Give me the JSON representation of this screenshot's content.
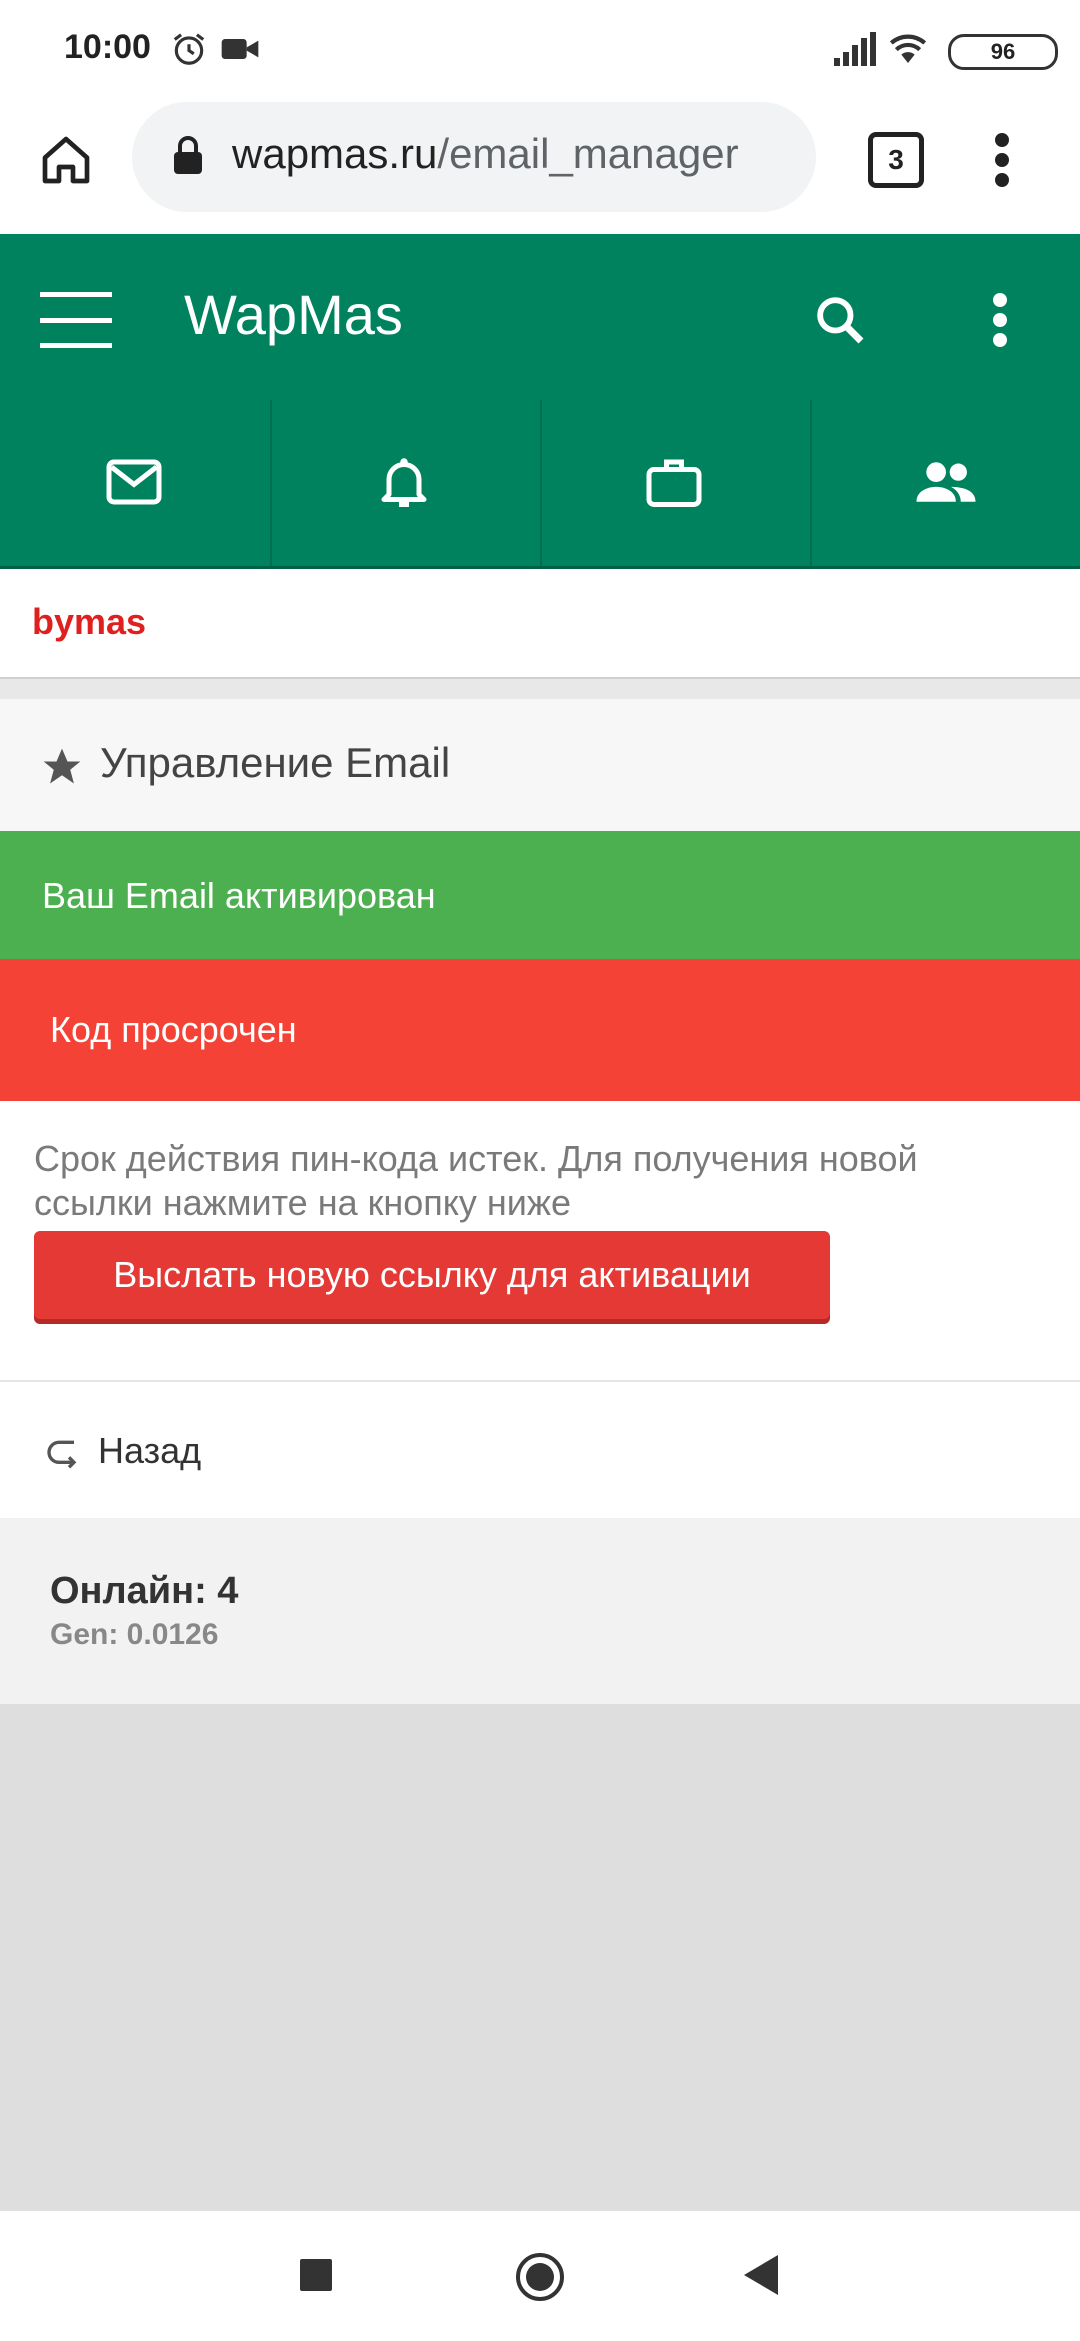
{
  "status_bar": {
    "time": "10:00",
    "battery": "96"
  },
  "browser": {
    "url_host": "wapmas.ru",
    "url_path": "/email_manager",
    "tab_count": "3"
  },
  "app": {
    "title": "WapMas"
  },
  "user": {
    "name": "bymas"
  },
  "section": {
    "title": "Управление Email"
  },
  "alerts": {
    "success": "Ваш Email активирован",
    "error": "Код просрочен"
  },
  "content": {
    "description": "Срок действия пин-кода истек. Для получения новой ссылки нажмите на кнопку ниже",
    "button_label": "Выслать новую ссылку для активации"
  },
  "back": {
    "label": "Назад"
  },
  "footer": {
    "online": "Онлайн: 4",
    "gen": "Gen: 0.0126"
  },
  "colors": {
    "brand": "#00825f",
    "success": "#4caf50",
    "error": "#f44336",
    "button": "#e53935",
    "username": "#e0201e"
  },
  "icons": [
    "alarm-icon",
    "video-icon",
    "signal-icon",
    "wifi-icon",
    "battery-icon",
    "home-icon",
    "lock-icon",
    "more-vert-icon",
    "menu-icon",
    "search-icon",
    "mail-icon",
    "bell-icon",
    "briefcase-icon",
    "people-icon",
    "star-icon",
    "back-arrow-icon",
    "nav-square-icon",
    "nav-circle-icon",
    "nav-back-icon"
  ]
}
